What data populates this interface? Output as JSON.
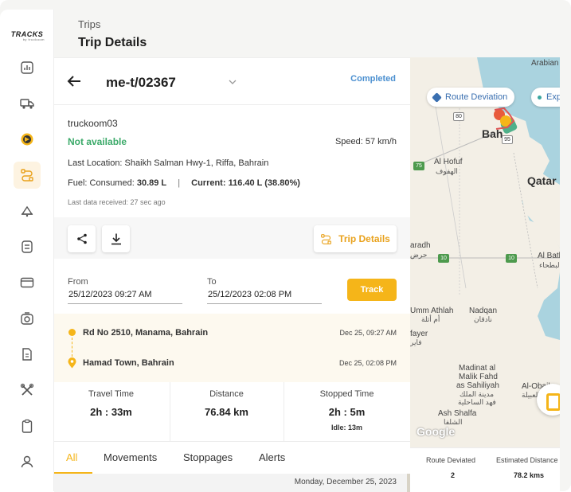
{
  "sidebar": {
    "logo": "TRACKS",
    "logo_sub": "by truckoom",
    "items": [
      {
        "icon": "analytics-icon"
      },
      {
        "icon": "truck-icon"
      },
      {
        "icon": "map-pin-icon"
      },
      {
        "icon": "trips-icon"
      },
      {
        "icon": "alerts-icon"
      },
      {
        "icon": "reports-icon"
      },
      {
        "icon": "card-icon"
      },
      {
        "icon": "camera-icon"
      },
      {
        "icon": "document-icon"
      },
      {
        "icon": "tools-icon"
      },
      {
        "icon": "clipboard-icon"
      },
      {
        "icon": "user-icon"
      }
    ],
    "active_index": 3,
    "accent_color": "#f5b519"
  },
  "header": {
    "breadcrumb": "Trips",
    "title": "Trip Details"
  },
  "trip": {
    "id": "me-t/02367",
    "status": "Completed",
    "vehicle": "truckoom03",
    "availability": "Not available",
    "speed": "Speed: 57 km/h",
    "location": "Last Location: Shaikh Salman Hwy-1, Riffa, Bahrain",
    "fuel_consumed_label": "Fuel: Consumed:",
    "fuel_consumed_value": "30.89 L",
    "fuel_sep": "|",
    "fuel_current_label": "Current:",
    "fuel_current_value": "116.40 L (38.80%)",
    "last_data": "Last data received: 27 sec ago"
  },
  "actions": {
    "share_icon": "share-icon",
    "download_icon": "download-icon",
    "trip_details_label": "Trip Details"
  },
  "filter": {
    "from_label": "From",
    "from_value": "25/12/2023 09:27 AM",
    "to_label": "To",
    "to_value": "25/12/2023 02:08 PM",
    "track_label": "Track"
  },
  "route": {
    "start_name": "Rd No 2510, Manama, Bahrain",
    "start_time": "Dec 25, 09:27 AM",
    "end_name": "Hamad Town, Bahrain",
    "end_time": "Dec 25, 02:08 PM"
  },
  "stats": [
    {
      "title": "Travel Time",
      "value": "2h : 33m"
    },
    {
      "title": "Distance",
      "value": "76.84 km"
    },
    {
      "title": "Stopped Time",
      "value": "2h : 5m",
      "extra": "Idle: 13m"
    }
  ],
  "tabs": [
    {
      "label": "All"
    },
    {
      "label": "Movements"
    },
    {
      "label": "Stoppages"
    },
    {
      "label": "Alerts"
    }
  ],
  "active_tab": "All",
  "date_header": "Monday, December 25, 2023",
  "map": {
    "chip_deviation": "Route Deviation",
    "chip_expected": "Exp",
    "labels": {
      "arabian_g": "Arabian G",
      "bahrain": "Bah",
      "al_hofuf": "Al Hofuf",
      "al_hofuf_ar": "الهفوف",
      "qatar": "Qatar",
      "haradh": "aradh",
      "haradh_ar": "حرض",
      "al_bath": "Al Bath",
      "al_bath_ar": "البطحاء",
      "umm_athlah": "Umm Athlah",
      "umm_athlah_ar": "أم أثلة",
      "nadqan": "Nadqan",
      "nadqan_ar": "نادقان",
      "fayer": "fayer",
      "fayer_ar": "فاير",
      "madinat": "Madinat al",
      "malik": "Malik Fahd",
      "sahiliyah": "as Sahiliyah",
      "madinat_ar": "مدينة الملك",
      "fahd_ar": "فهد الساحلية",
      "al_obail": "Al-Obail",
      "al_obail_ar": "العبيلة",
      "ash_shalfa": "Ash Shalfa",
      "ash_shalfa_ar": "الشلفا",
      "google": "Google"
    },
    "highways": [
      "80",
      "75",
      "10",
      "10",
      "95"
    ]
  },
  "summary": {
    "route_deviated_label": "Route Deviated",
    "route_deviated_value": "2",
    "estimated_distance_label": "Estimated Distance",
    "estimated_distance_value": "78.2 kms"
  }
}
